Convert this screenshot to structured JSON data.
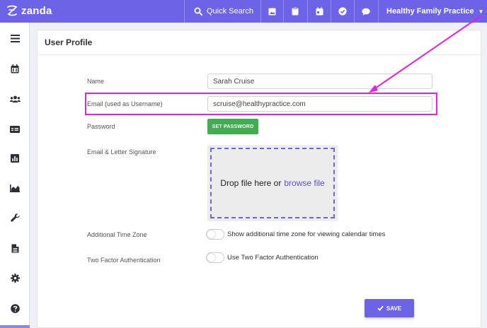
{
  "topbar": {
    "brand": "zanda",
    "quick_search": "Quick Search",
    "practice_name": "Healthy Family Practice",
    "practice_caret": "▼",
    "icons": [
      "image-icon",
      "clipboard-icon",
      "calendar-icon",
      "check-circle-icon",
      "chat-icon"
    ]
  },
  "sidebar": {
    "items": [
      "menu-icon",
      "calendar-icon",
      "users-icon",
      "id-card-icon",
      "bar-chart-icon",
      "area-chart-icon",
      "wrench-icon",
      "document-icon",
      "gear-icon",
      "help-icon"
    ]
  },
  "profile": {
    "title": "User Profile",
    "name_label": "Name",
    "name_value": "Sarah Cruise",
    "email_label": "Email (used as Username)",
    "email_value": "scruise@healthypractice.com",
    "password_label": "Password",
    "set_password": "SET PASSWORD",
    "signature_label": "Email & Letter Signature",
    "drop_text": "Drop file here or",
    "browse_text": "browse file",
    "tz_label": "Additional Time Zone",
    "tz_text": "Show additional time zone for viewing calendar times",
    "tz_enabled": false,
    "tfa_label": "Two Factor Authentication",
    "tfa_text": "Use Two Factor Authentication",
    "tfa_enabled": false,
    "save": "SAVE"
  },
  "colors": {
    "brand": "#6c63e6",
    "highlight": "#e61fe0",
    "green": "#3fae4f"
  }
}
